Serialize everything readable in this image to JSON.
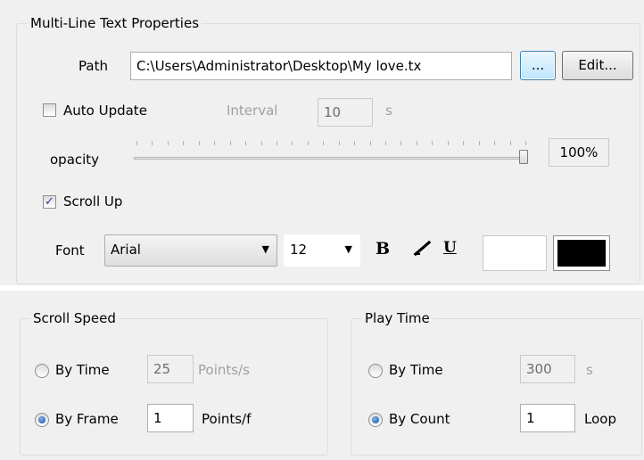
{
  "text_props": {
    "title": "Multi-Line Text Properties",
    "path_label": "Path",
    "path_value": "C:\\Users\\Administrator\\Desktop\\My love.tx",
    "browse_button": "...",
    "edit_button": "Edit...",
    "auto_update_label": "Auto Update",
    "auto_update_checked": false,
    "interval_label": "Interval",
    "interval_value": "10",
    "interval_unit": "s",
    "opacity_label": "opacity",
    "opacity_value": "100%",
    "opacity_level": 1.0,
    "scroll_up_label": "Scroll Up",
    "scroll_up_checked": true,
    "font_label": "Font",
    "font_value": "Arial",
    "size_value": "12",
    "bold_label": "B",
    "italic_label": "I",
    "underline_label": "U",
    "fg_color": "#ffffff",
    "bg_color": "#000000"
  },
  "scroll_speed": {
    "title": "Scroll Speed",
    "by_time_label": "By Time",
    "by_time_value": "25",
    "by_time_unit": "Points/s",
    "by_frame_label": "By Frame",
    "by_frame_value": "1",
    "by_frame_unit": "Points/f",
    "selected": "by_frame"
  },
  "play_time": {
    "title": "Play Time",
    "by_time_label": "By Time",
    "by_time_value": "300",
    "by_time_unit": "s",
    "by_count_label": "By Count",
    "by_count_value": "1",
    "by_count_unit": "Loop",
    "selected": "by_count"
  }
}
